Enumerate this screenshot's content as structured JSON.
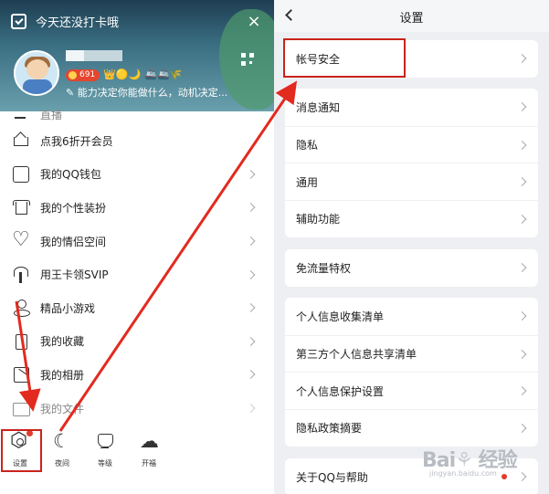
{
  "left_panel": {
    "checkin_text": "今天还没打卡哦",
    "close_glyph": "×",
    "vip_level": "691",
    "level_icons": "👑🟡🌙",
    "level_icons2": "🚢🚢🌾",
    "signature": "✎ 能力决定你能做什么，动机决定...",
    "menu": [
      {
        "label": "直播",
        "icon": "live-icon"
      },
      {
        "label": "点我6折开会员",
        "icon": "crown-icon"
      },
      {
        "label": "我的QQ钱包",
        "icon": "wallet-icon"
      },
      {
        "label": "我的个性装扮",
        "icon": "shirt-icon"
      },
      {
        "label": "我的情侣空间",
        "icon": "heart-icon"
      },
      {
        "label": "用王卡领SVIP",
        "icon": "antenna-icon"
      },
      {
        "label": "精品小游戏",
        "icon": "game-icon"
      },
      {
        "label": "我的收藏",
        "icon": "bookmark-icon"
      },
      {
        "label": "我的相册",
        "icon": "photo-icon"
      },
      {
        "label": "我的文件",
        "icon": "folder-icon"
      }
    ],
    "bottom_bar": [
      {
        "label": "设置",
        "icon": "settings-icon"
      },
      {
        "label": "夜间",
        "icon": "moon-icon"
      },
      {
        "label": "等级",
        "icon": "cup-icon"
      },
      {
        "label": "开福",
        "icon": "weather-icon"
      }
    ]
  },
  "right_panel": {
    "title": "设置",
    "groups": [
      [
        "帐号安全"
      ],
      [
        "消息通知",
        "隐私",
        "通用",
        "辅助功能"
      ],
      [
        "免流量特权"
      ],
      [
        "个人信息收集清单",
        "第三方个人信息共享清单",
        "个人信息保护设置",
        "隐私政策摘要"
      ],
      [
        "关于QQ与帮助"
      ]
    ]
  },
  "watermark": {
    "brand": "Bai",
    "brand2": "经验",
    "site": "jingyan.baidu.com"
  },
  "colors": {
    "highlight": "#c9231b",
    "badge_red": "#e53b2c",
    "settings_bg": "#eeeff3"
  }
}
